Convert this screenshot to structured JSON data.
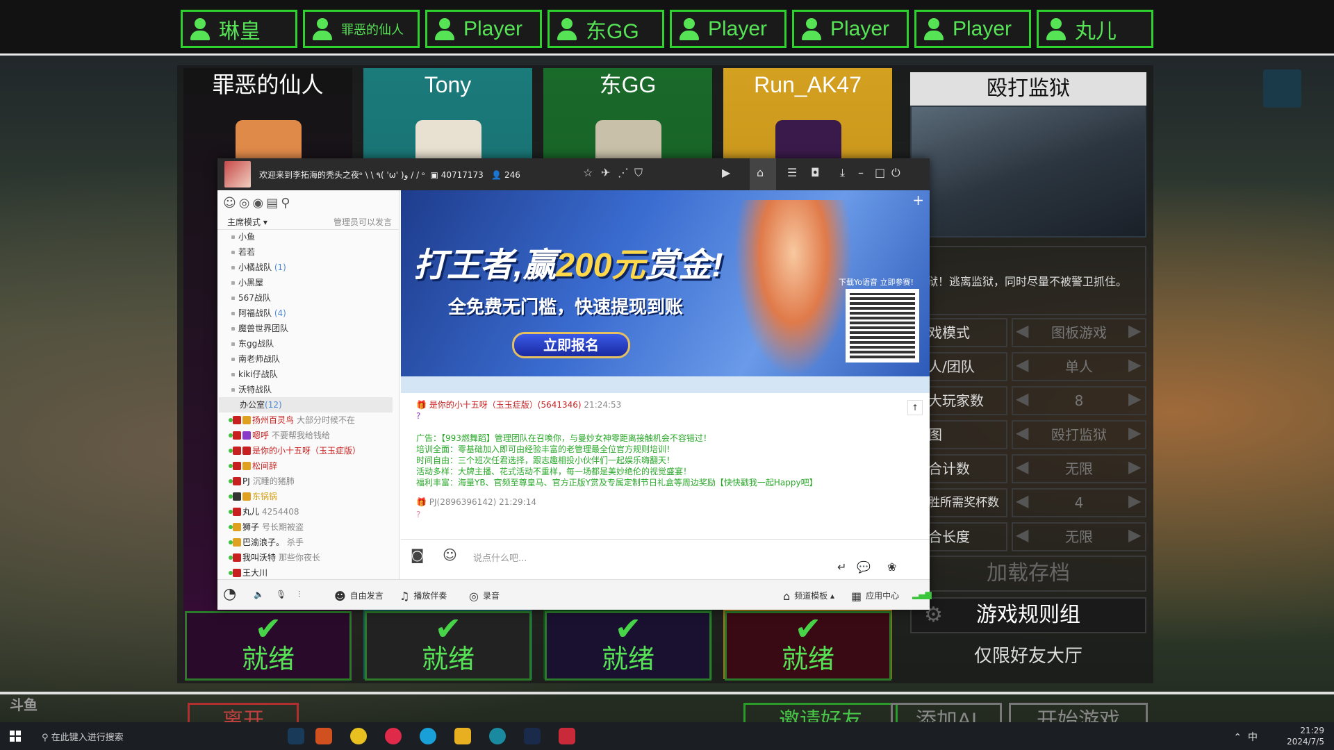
{
  "players": [
    "琳皇",
    "罪恶的仙人",
    "Player",
    "东GG",
    "Player",
    "Player",
    "Player",
    "丸儿"
  ],
  "cards": [
    {
      "name": "罪恶的仙人",
      "status": "就绪",
      "color": "#1a1a1a"
    },
    {
      "name": "Tony",
      "status": "就绪",
      "color": "#1b6a6a"
    },
    {
      "name": "东GG",
      "status": "就绪",
      "color": "#1a5a2a"
    },
    {
      "name": "Run_AK47",
      "status": "就绪",
      "color": "#b8861a"
    }
  ],
  "map": {
    "name": "殴打监狱",
    "description": "狱！逃离监狱，同时尽量不被警卫抓住。"
  },
  "settings": [
    {
      "label": "戏模式",
      "value": "图板游戏"
    },
    {
      "label": "人/团队",
      "value": "单人"
    },
    {
      "label": "大玩家数",
      "value": "8"
    },
    {
      "label": "图",
      "value": "殴打监狱"
    },
    {
      "label": "合计数",
      "value": "无限"
    },
    {
      "label": "胜所需奖杯数",
      "value": "4"
    },
    {
      "label": "合长度",
      "value": "无限"
    }
  ],
  "buttons": {
    "load_save": "加载存档",
    "rule_group": "游戏规则组",
    "friends_only": "仅限好友大厅",
    "leave": "离开",
    "invite": "邀请好友",
    "add_ai": "添加AI",
    "start": "开始游戏"
  },
  "watermark": "斗鱼",
  "chat_window": {
    "title": "欢迎来到李拓海的秃头之夜ᵒ \\ \\ ٩( 'ω' )و / / ᵒ",
    "room_id": "40717173",
    "online": "246",
    "mode": "主席模式",
    "mode_note": "管理员可以发言",
    "channels": [
      {
        "name": "小鱼",
        "count": ""
      },
      {
        "name": "若若",
        "count": ""
      },
      {
        "name": "小橘战队",
        "count": "(1)"
      },
      {
        "name": "小黑屋",
        "count": ""
      },
      {
        "name": "567战队",
        "count": ""
      },
      {
        "name": "阿福战队",
        "count": "(4)"
      },
      {
        "name": "魔兽世界团队",
        "count": ""
      },
      {
        "name": "东gg战队",
        "count": ""
      },
      {
        "name": "南老师战队",
        "count": ""
      },
      {
        "name": "kiki仔战队",
        "count": ""
      },
      {
        "name": "沃特战队",
        "count": ""
      }
    ],
    "office": {
      "name": "办公室",
      "count": "(12)"
    },
    "members": [
      {
        "name": "扬州百灵鸟",
        "status": "大部分时候不在",
        "color": "#c82020"
      },
      {
        "name": "嗯呼",
        "status": "不要帮我给钱给",
        "color": "#c82020"
      },
      {
        "name": "是你的小十五呀（玉玉症版）",
        "status": "",
        "color": "#c82020"
      },
      {
        "name": "松间辞",
        "status": "",
        "color": "#c82020"
      },
      {
        "name": "PJ",
        "status": "沉睡的猪肺",
        "color": "#222"
      },
      {
        "name": "东锅锅",
        "status": "",
        "color": "#d4a010"
      },
      {
        "name": "丸儿",
        "status": "4254408",
        "color": "#222"
      },
      {
        "name": "狮子",
        "status": "号长期被盗",
        "color": "#222"
      },
      {
        "name": "巴渝浪子。",
        "status": "杀手",
        "color": "#222"
      },
      {
        "name": "我叫沃特",
        "status": "那些你夜长",
        "color": "#222"
      },
      {
        "name": "王大川",
        "status": "",
        "color": "#222"
      }
    ],
    "banner": {
      "title_a": "打王者,赢",
      "title_b": "200元",
      "title_c": "赏金!",
      "subtitle": "全免费无门槛，快速提现到账",
      "register": "立即报名",
      "qr_note": "下载Yo语音 立即参赛!"
    },
    "messages": {
      "user1": "是你的小十五呀（玉玉症版）(5641346)",
      "time1": "21:24:53",
      "q1": "?",
      "ad_lines": [
        "广告：【993燃舞蹈】管理团队在召唤你，与曼妙女神零距离接触机会不容错过！",
        "培训全面：零基础加入即可由经验丰富的老管理最全位官方规则培训！",
        "时间自由：三个班次任君选择，跟志趣相投小伙伴们一起娱乐嗨翻天！",
        "活动多样：大牌主播、花式活动不重样，每一场都是美妙绝伦的视觉盛宴！",
        "福利丰富：海量YB、官频至尊皇马、官方正版Y赏及专属定制节日礼盒等周边奖励【快快戳我一起Happy吧】"
      ],
      "user2": "PJ(2896396142)",
      "time2": "21:29:14",
      "q2": "?"
    },
    "input_placeholder": "说点什么吧...",
    "footer": {
      "free_talk": "自由发言",
      "play_music": "播放伴奏",
      "record": "录音",
      "template": "频道模板",
      "app_center": "应用中心"
    }
  },
  "taskbar": {
    "search_placeholder": "在此键入进行搜索",
    "ime": "中",
    "time": "21:29",
    "date": "2024/7/5"
  }
}
